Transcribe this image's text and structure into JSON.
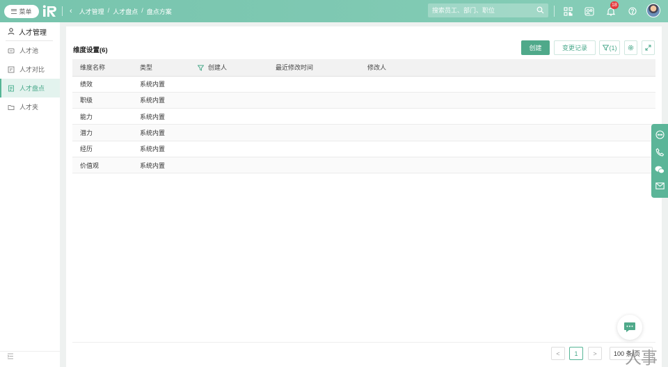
{
  "topbar": {
    "menu_label": "菜单",
    "breadcrumb": [
      "人才管理",
      "/",
      "人才盘点",
      "/",
      "盘点方案"
    ],
    "search_placeholder": "搜索员工、部门、职位",
    "notification_count": "18"
  },
  "sidebar": {
    "title": "人才管理",
    "items": [
      {
        "label": "人才池",
        "icon": "pool-icon",
        "active": false
      },
      {
        "label": "人才对比",
        "icon": "compare-icon",
        "active": false
      },
      {
        "label": "人才盘点",
        "icon": "inventory-icon",
        "active": true
      },
      {
        "label": "人才夹",
        "icon": "folder-icon",
        "active": false
      }
    ]
  },
  "card": {
    "title": "维度设置(6)",
    "buttons": {
      "create": "创建",
      "change_log": "变更记录",
      "filter": "(1)"
    }
  },
  "table": {
    "columns": [
      "维度名称",
      "类型",
      "创建人",
      "最近修改时间",
      "修改人"
    ],
    "rows": [
      [
        "绩效",
        "系统内置",
        "",
        "",
        ""
      ],
      [
        "职级",
        "系统内置",
        "",
        "",
        ""
      ],
      [
        "能力",
        "系统内置",
        "",
        "",
        ""
      ],
      [
        "潜力",
        "系统内置",
        "",
        "",
        ""
      ],
      [
        "经历",
        "系统内置",
        "",
        "",
        ""
      ],
      [
        "价值观",
        "系统内置",
        "",
        "",
        ""
      ]
    ]
  },
  "pagination": {
    "prev": "<",
    "current": "1",
    "next": ">",
    "page_size": "100 条/页"
  },
  "watermark": "人事",
  "colors": {
    "accent": "#4fa98a",
    "topbar": "#7fc8b1",
    "badge": "#e4393c"
  }
}
